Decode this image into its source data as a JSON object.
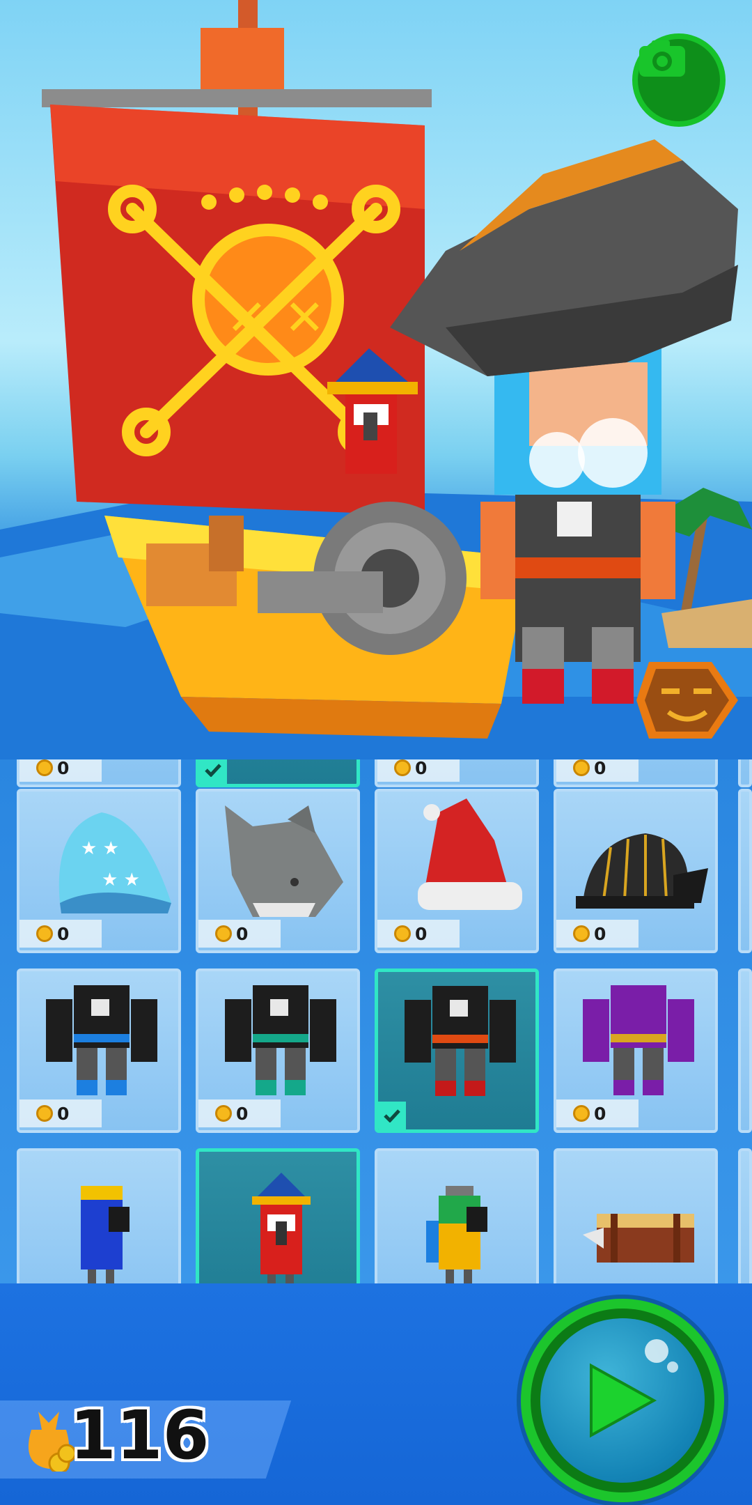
{
  "hud": {
    "camera_button": {
      "icon": "camera-icon",
      "color": "#17c22a"
    },
    "emote_button": {
      "icon": "face-emote-icon",
      "color": "#e97a12"
    },
    "play_button": {
      "icon": "play-icon",
      "color": "#1cc52c"
    },
    "currency": {
      "icon": "coin-bag-icon",
      "amount": "116"
    }
  },
  "scene": {
    "description_icons": [
      "pirate-ship",
      "skull-flag",
      "cannon",
      "parrot",
      "pirate-character"
    ]
  },
  "grid": {
    "row_partial": [
      {
        "price": "0",
        "selected": false
      },
      {
        "price": "",
        "selected": true
      },
      {
        "price": "0",
        "selected": false
      },
      {
        "price": "0",
        "selected": false
      }
    ],
    "row_hats": [
      {
        "item": "star-beanie-hat-icon",
        "price": "0",
        "selected": false
      },
      {
        "item": "shark-hat-icon",
        "price": "0",
        "selected": false
      },
      {
        "item": "santa-hat-icon",
        "price": "0",
        "selected": false
      },
      {
        "item": "snail-helmet-icon",
        "price": "0",
        "selected": false
      }
    ],
    "row_outfits": [
      {
        "item": "blue-pirate-outfit-icon",
        "price": "0",
        "selected": false
      },
      {
        "item": "green-pirate-outfit-icon",
        "price": "0",
        "selected": false
      },
      {
        "item": "red-pirate-outfit-icon",
        "price": "",
        "selected": true
      },
      {
        "item": "purple-pirate-outfit-icon",
        "price": "0",
        "selected": false
      }
    ],
    "row_pets": [
      {
        "item": "blue-parrot-icon",
        "selected": false
      },
      {
        "item": "captain-parrot-icon",
        "selected": true
      },
      {
        "item": "green-parrot-icon",
        "selected": false
      },
      {
        "item": "treasure-chest-pet-icon",
        "selected": false
      }
    ]
  }
}
